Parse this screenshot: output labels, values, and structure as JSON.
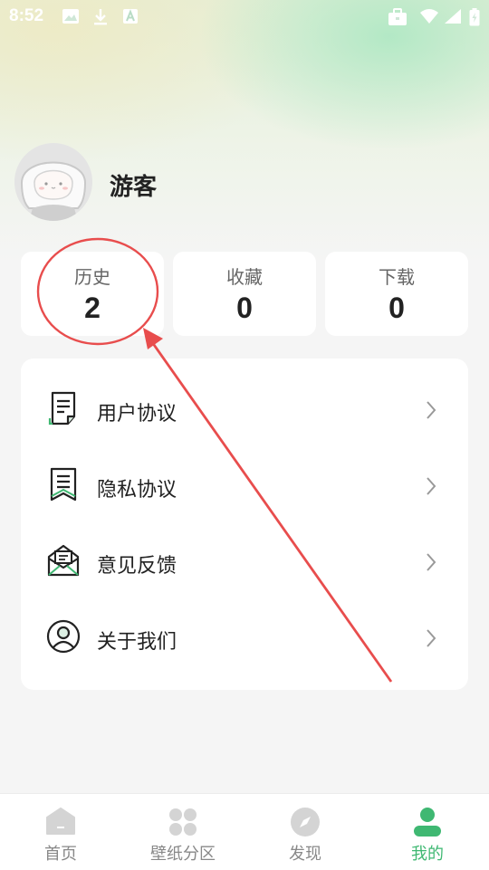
{
  "status_bar": {
    "time": "8:52"
  },
  "profile": {
    "username": "游客"
  },
  "stats": [
    {
      "label": "历史",
      "value": "2"
    },
    {
      "label": "收藏",
      "value": "0"
    },
    {
      "label": "下载",
      "value": "0"
    }
  ],
  "menu": [
    {
      "label": "用户协议",
      "icon": "document-icon"
    },
    {
      "label": "隐私协议",
      "icon": "privacy-document-icon"
    },
    {
      "label": "意见反馈",
      "icon": "mail-feedback-icon"
    },
    {
      "label": "关于我们",
      "icon": "user-circle-icon"
    }
  ],
  "nav": [
    {
      "label": "首页",
      "icon": "home-icon"
    },
    {
      "label": "壁纸分区",
      "icon": "grid-icon"
    },
    {
      "label": "发现",
      "icon": "compass-icon"
    },
    {
      "label": "我的",
      "icon": "person-icon",
      "active": true
    }
  ],
  "colors": {
    "accent": "#3fb872",
    "annotation": "#e84d4d"
  }
}
